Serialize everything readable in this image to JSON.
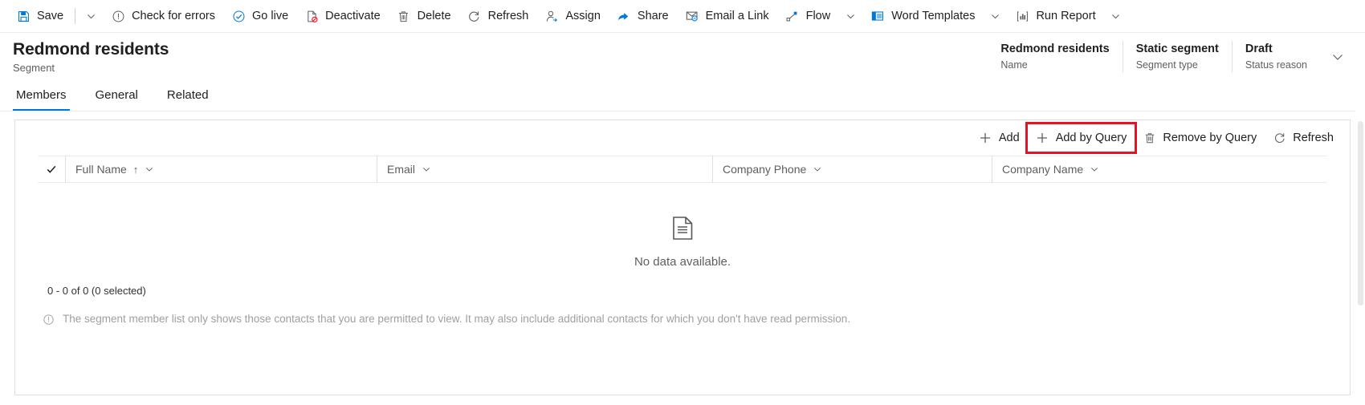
{
  "command_bar": {
    "items": [
      {
        "icon": "save-icon",
        "label": "Save",
        "caret": true
      },
      {
        "icon": "error-circle-icon",
        "label": "Check for errors",
        "caret": false
      },
      {
        "icon": "check-circle-icon",
        "label": "Go live",
        "caret": false
      },
      {
        "icon": "deactivate-icon",
        "label": "Deactivate",
        "caret": false
      },
      {
        "icon": "trash-icon",
        "label": "Delete",
        "caret": false
      },
      {
        "icon": "refresh-icon",
        "label": "Refresh",
        "caret": false
      },
      {
        "icon": "assign-person-icon",
        "label": "Assign",
        "caret": false
      },
      {
        "icon": "share-icon",
        "label": "Share",
        "caret": false
      },
      {
        "icon": "email-link-icon",
        "label": "Email a Link",
        "caret": false
      },
      {
        "icon": "flow-icon",
        "label": "Flow",
        "caret": true
      },
      {
        "icon": "word-templates-icon",
        "label": "Word Templates",
        "caret": true
      },
      {
        "icon": "run-report-icon",
        "label": "Run Report",
        "caret": true
      }
    ]
  },
  "record": {
    "title": "Redmond residents",
    "subtitle": "Segment",
    "fields": [
      {
        "value": "Redmond residents",
        "label": "Name"
      },
      {
        "value": "Static segment",
        "label": "Segment type"
      },
      {
        "value": "Draft",
        "label": "Status reason"
      }
    ]
  },
  "tabs": [
    {
      "label": "Members",
      "active": true
    },
    {
      "label": "General",
      "active": false
    },
    {
      "label": "Related",
      "active": false
    }
  ],
  "grid": {
    "commands": [
      {
        "icon": "plus-icon",
        "label": "Add",
        "highlight": false
      },
      {
        "icon": "plus-icon",
        "label": "Add by Query",
        "highlight": true
      },
      {
        "icon": "trash-icon",
        "label": "Remove by Query",
        "highlight": false
      },
      {
        "icon": "refresh-icon",
        "label": "Refresh",
        "highlight": false
      }
    ],
    "columns": [
      {
        "label": "Full Name",
        "sorted": true,
        "sort_direction": "↑"
      },
      {
        "label": "Email",
        "sorted": false,
        "sort_direction": ""
      },
      {
        "label": "Company Phone",
        "sorted": false,
        "sort_direction": ""
      },
      {
        "label": "Company Name",
        "sorted": false,
        "sort_direction": ""
      }
    ],
    "empty_message": "No data available.",
    "record_count": "0 - 0 of 0 (0 selected)",
    "footer_note": "The segment member list only shows those contacts that you are permitted to view. It may also include additional contacts for which you don't have read permission."
  },
  "colors": {
    "accent": "#0078d4",
    "highlight": "#e81123",
    "text": "#201f1e",
    "muted": "#605e5c"
  }
}
